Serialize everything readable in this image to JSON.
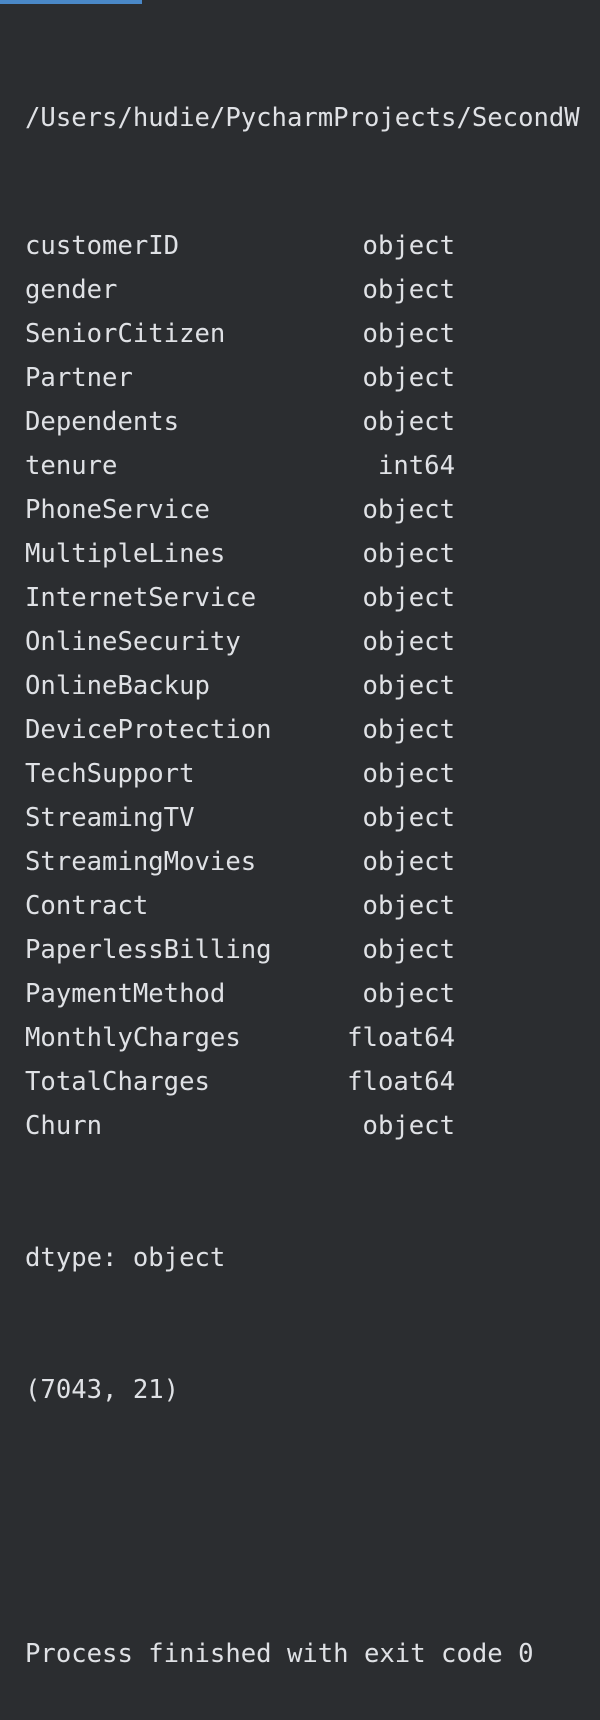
{
  "run": {
    "progress_fraction": 0.236,
    "path": "/Users/hudie/PycharmProjects/SecondW"
  },
  "dtypes": [
    {
      "name": "customerID",
      "type": "object"
    },
    {
      "name": "gender",
      "type": "object"
    },
    {
      "name": "SeniorCitizen",
      "type": "object"
    },
    {
      "name": "Partner",
      "type": "object"
    },
    {
      "name": "Dependents",
      "type": "object"
    },
    {
      "name": "tenure",
      "type": "int64"
    },
    {
      "name": "PhoneService",
      "type": "object"
    },
    {
      "name": "MultipleLines",
      "type": "object"
    },
    {
      "name": "InternetService",
      "type": "object"
    },
    {
      "name": "OnlineSecurity",
      "type": "object"
    },
    {
      "name": "OnlineBackup",
      "type": "object"
    },
    {
      "name": "DeviceProtection",
      "type": "object"
    },
    {
      "name": "TechSupport",
      "type": "object"
    },
    {
      "name": "StreamingTV",
      "type": "object"
    },
    {
      "name": "StreamingMovies",
      "type": "object"
    },
    {
      "name": "Contract",
      "type": "object"
    },
    {
      "name": "PaperlessBilling",
      "type": "object"
    },
    {
      "name": "PaymentMethod",
      "type": "object"
    },
    {
      "name": "MonthlyCharges",
      "type": "float64"
    },
    {
      "name": "TotalCharges",
      "type": "float64"
    },
    {
      "name": "Churn",
      "type": "object"
    }
  ],
  "summary": {
    "dtype_line": "dtype: object",
    "shape_line": "(7043, 21)"
  },
  "exit_message": "Process finished with exit code 0",
  "colors": {
    "background": "#2b2d30",
    "text": "#dfe1e5",
    "accent": "#4a88c7"
  }
}
